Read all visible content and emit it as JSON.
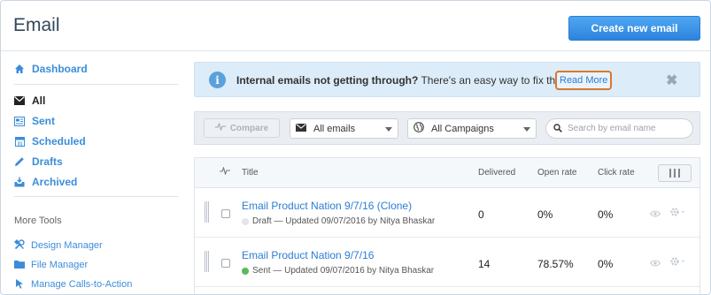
{
  "page": {
    "title": "Email",
    "create_button": "Create new email"
  },
  "sidebar": {
    "items": [
      {
        "label": "Dashboard",
        "icon": "home-icon",
        "active": false
      },
      {
        "label": "All",
        "icon": "envelope-icon",
        "active": true
      },
      {
        "label": "Sent",
        "icon": "sent-icon",
        "active": false
      },
      {
        "label": "Scheduled",
        "icon": "calendar-icon",
        "active": false
      },
      {
        "label": "Drafts",
        "icon": "pencil-icon",
        "active": false
      },
      {
        "label": "Archived",
        "icon": "archive-icon",
        "active": false
      }
    ],
    "more_tools_label": "More Tools",
    "tools": [
      {
        "label": "Design Manager",
        "icon": "tools-icon"
      },
      {
        "label": "File Manager",
        "icon": "folder-icon"
      },
      {
        "label": "Manage Calls-to-Action",
        "icon": "cta-icon"
      }
    ]
  },
  "banner": {
    "bold": "Internal emails not getting through?",
    "text": " There's an easy way to fix that.",
    "link": "Read More",
    "close": "✖"
  },
  "toolbar": {
    "compare_label": "Compare",
    "email_filter": "All emails",
    "campaign_filter": "All Campaigns",
    "search_placeholder": "Search by email name",
    "search_value": ""
  },
  "table": {
    "columns": {
      "title": "Title",
      "delivered": "Delivered",
      "open_rate": "Open rate",
      "click_rate": "Click rate"
    },
    "rows": [
      {
        "title": "Email Product Nation 9/7/16 (Clone)",
        "meta": "Draft — Updated 09/07/2016 by Nitya Bhaskar",
        "status_color": "#e3e7eb",
        "delivered": "0",
        "open_rate": "0%",
        "click_rate": "0%"
      },
      {
        "title": "Email Product Nation 9/7/16",
        "meta": "Sent — Updated 09/07/2016 by Nitya Bhaskar",
        "status_color": "#5cb85c",
        "delivered": "14",
        "open_rate": "78.57%",
        "click_rate": "0%"
      }
    ]
  },
  "colors": {
    "accent": "#3b8dd9",
    "button": "#2d83dc",
    "highlight": "#d9782f"
  }
}
